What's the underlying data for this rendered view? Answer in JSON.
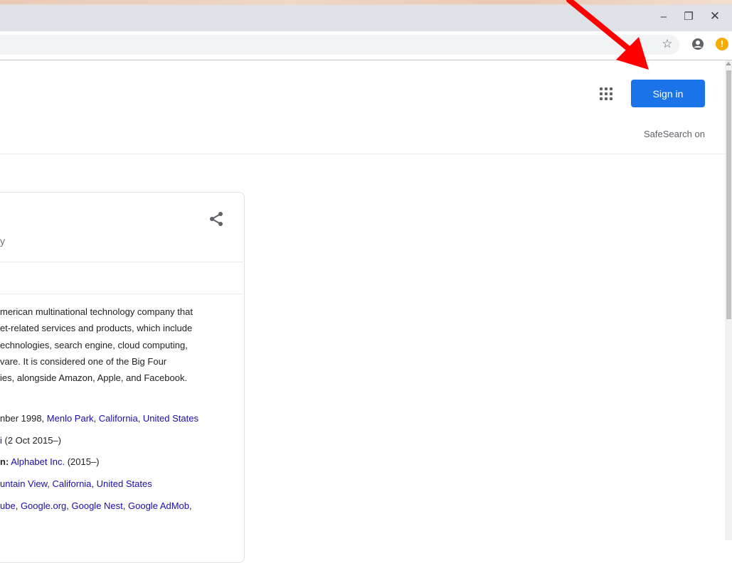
{
  "window": {
    "minimize_glyph": "–",
    "restore_glyph": "❐",
    "close_glyph": "✕"
  },
  "toolbar": {
    "star_icon": "☆",
    "alert_glyph": "!"
  },
  "header": {
    "signin_label": "Sign in",
    "safesearch_label": "SafeSearch on",
    "signin_color": "#1a73e8"
  },
  "knowledge_panel": {
    "subtitle_fragment": "y",
    "description_lines": [
      "merican multinational technology company that",
      "et-related services and products, which include",
      "echnologies, search engine, cloud computing,",
      "vare. It is considered one of the Big Four",
      "ies, alongside Amazon, Apple, and Facebook."
    ],
    "facts": {
      "founded_prefix": "nber 1998, ",
      "founded_link_1": "Menlo Park",
      "founded_sep_1": ", ",
      "founded_link_2": "California",
      "founded_sep_2": ", ",
      "founded_link_3": "United States",
      "ceo_link": "i",
      "ceo_suffix": " (2 Oct 2015–)",
      "parent_label": "n:",
      "parent_link": "Alphabet Inc.",
      "parent_suffix": " (2015–)",
      "hq_link_1": "untain View",
      "hq_sep_1": ", ",
      "hq_link_2": "California",
      "hq_sep_2": ", ",
      "hq_link_3": "United States",
      "subs_link_1": "ube",
      "subs_sep_1": ", ",
      "subs_link_2": "Google.org",
      "subs_sep_2": ", ",
      "subs_link_3": "Google Nest",
      "subs_sep_3": ", ",
      "subs_link_4": "Google AdMob",
      "subs_sep_4": ","
    }
  },
  "colors": {
    "link": "#1a0dab",
    "annotation_arrow": "#ff0000",
    "alert": "#f9ab00"
  }
}
